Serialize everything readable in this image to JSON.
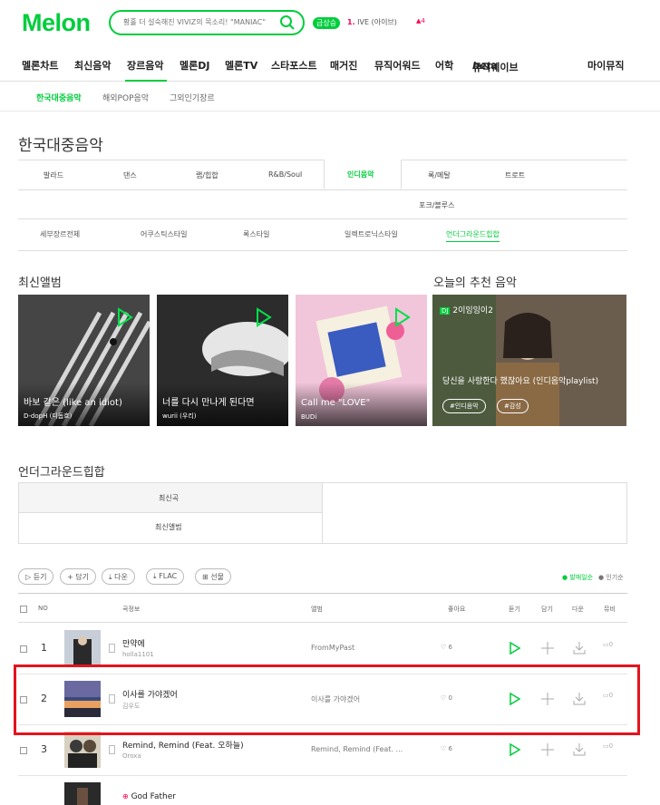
{
  "header": {
    "logo": "Melon",
    "search_placeholder": "황홀 더 설숙해진 VIVIZ의 목소리! \"MANIAC\"",
    "live_badge": "급상승",
    "rank_num": "1.",
    "rank_text": "IVE (아이브)",
    "rank_change": "4"
  },
  "gnb": [
    "멜론차트",
    "최신음악",
    "장르음악",
    "멜론DJ",
    "멜론TV",
    "스타포스트",
    "매거진",
    "뮤직어워드",
    "어학",
    "뮤직웨이브",
    "마이뮤직"
  ],
  "gnb_beta": "beta",
  "subnav": [
    "한국대중음악",
    "해외POP음악",
    "그외인기장르"
  ],
  "page_title": "한국대중음악",
  "genres_row1": [
    "발라드",
    "댄스",
    "랩/힙합",
    "R&B/Soul",
    "인디음악",
    "록/메탈",
    "트로트"
  ],
  "genres_row2": [
    "포크/블루스"
  ],
  "subgenres": [
    "세부장르전체",
    "어쿠스틱스타일",
    "록스타일",
    "일렉트로닉스타일",
    "언더그라운드힙합"
  ],
  "latest_albums_title": "최신앨범",
  "albums": [
    {
      "title": "바보 같은 (like an idiot)",
      "artist": "D-dopH (디돕흐)",
      "color": "#3a3a3a"
    },
    {
      "title": "너를 다시 만나게 된다면",
      "artist": "wurii (우리)",
      "color": "#2a2a2a"
    },
    {
      "title": "Call me \"LOVE\"",
      "artist": "BUDi",
      "color": "#e97aa4"
    }
  ],
  "recommend": {
    "section_title": "오늘의 추천 음악",
    "label": "2이잉잉이2",
    "title": "당신을 사랑한다 했잖아요 (인디음악playlist)",
    "tags": [
      "#인디음악",
      "#감성"
    ]
  },
  "underground_title": "언더그라운드힙합",
  "tabs": [
    "최신곡",
    "최신앨범"
  ],
  "actions": [
    "듣기",
    "담기",
    "다운",
    "FLAC",
    "선물"
  ],
  "sort": {
    "release": "발매일순",
    "popular": "인기순"
  },
  "table_headers": {
    "no": "NO",
    "song": "곡정보",
    "album": "앨범",
    "like": "좋아요",
    "listen": "듣기",
    "add": "담기",
    "down": "다운",
    "mv": "뮤비"
  },
  "rows": [
    {
      "no": "1",
      "song": "만약에",
      "artist": "holla1101",
      "album": "FromMyPast",
      "likes": "6",
      "mv": "0",
      "color": "#a0a8b8"
    },
    {
      "no": "2",
      "song": "이사를 가야겠어",
      "artist": "김우도",
      "album": "이사를 가야겠어",
      "likes": "0",
      "mv": "0",
      "color": "#6a5a8a"
    },
    {
      "no": "3",
      "song": "Remind, Remind (Feat. 오하늘)",
      "artist": "Oroxa",
      "album": "Remind, Remind (Feat. ...",
      "likes": "6",
      "mv": "0",
      "color": "#555"
    },
    {
      "no": "4",
      "song": "God Father",
      "artist": "",
      "album": "",
      "likes": "",
      "mv": "",
      "color": "#333"
    }
  ],
  "colors": {
    "brand": "#00cd3c",
    "highlight": "#e3141d"
  }
}
